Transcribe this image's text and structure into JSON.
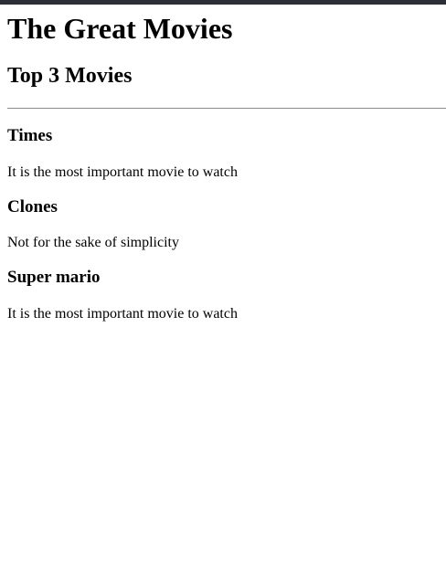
{
  "page": {
    "title": "The Great Movies",
    "section_title": "Top 3 Movies"
  },
  "movies": [
    {
      "title": "Times",
      "description": "It is the most important movie to watch"
    },
    {
      "title": "Clones",
      "description": "Not for the sake of simplicity"
    },
    {
      "title": "Super mario",
      "description": "It is the most important movie to watch"
    }
  ]
}
